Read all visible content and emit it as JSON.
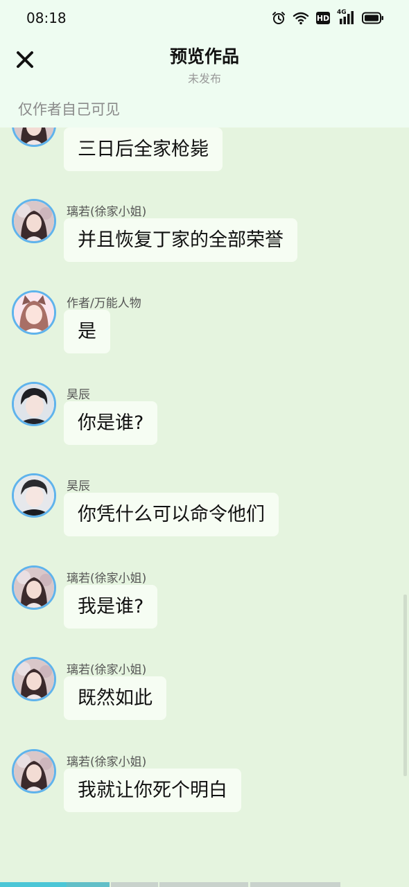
{
  "status_bar": {
    "time": "08:18",
    "hd": "HD",
    "net": "4G"
  },
  "header": {
    "title": "预览作品",
    "subtitle": "未发布"
  },
  "visibility_note": "仅作者自己可见",
  "messages": [
    {
      "sender": "",
      "text": "三日后全家枪毙",
      "avatar": "lady-avatar"
    },
    {
      "sender": "璃若(徐家小姐)",
      "text": "并且恢复丁家的全部荣誉",
      "avatar": "lady-avatar"
    },
    {
      "sender": "作者/万能人物",
      "text": "是",
      "avatar": "catgirl-avatar"
    },
    {
      "sender": "昊辰",
      "text": "你是谁?",
      "avatar": "man-avatar"
    },
    {
      "sender": "昊辰",
      "text": "你凭什么可以命令他们",
      "avatar": "man-avatar"
    },
    {
      "sender": "璃若(徐家小姐)",
      "text": "我是谁?",
      "avatar": "lady-avatar"
    },
    {
      "sender": "璃若(徐家小姐)",
      "text": "既然如此",
      "avatar": "lady-avatar"
    },
    {
      "sender": "璃若(徐家小姐)",
      "text": "我就让你死个明白",
      "avatar": "lady-avatar"
    }
  ],
  "colors": {
    "background": "#e5f4df",
    "header_bg": "#eefcf1",
    "bubble_bg": "#f6fdf3",
    "avatar_ring": "#5fb3ec",
    "progress_active": "#4cc6d6"
  }
}
